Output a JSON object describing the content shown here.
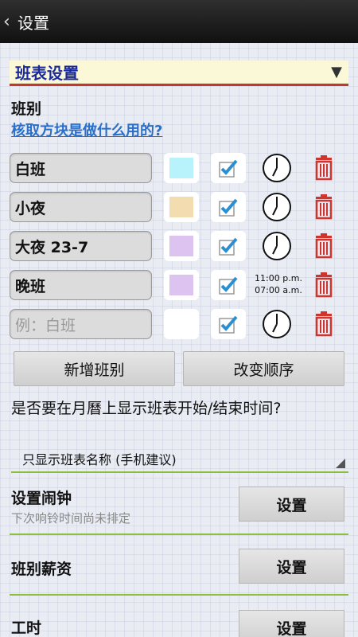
{
  "appbar": {
    "title": "设置"
  },
  "section_select": {
    "value": "班表设置"
  },
  "shifts_section": {
    "title": "班别",
    "help_link": "核取方块是做什么用的?",
    "rows": [
      {
        "name": "白班",
        "color": "#b8f2fb",
        "checked": true,
        "time": ""
      },
      {
        "name": "小夜",
        "color": "#f2dcb0",
        "checked": true,
        "time": ""
      },
      {
        "name": "大夜 23-7",
        "color": "#ddc3f0",
        "checked": true,
        "time": ""
      },
      {
        "name": "晚班",
        "color": "#ddc3f0",
        "checked": true,
        "time_start": "11:00 p.m.",
        "time_end": "07:00 a.m."
      },
      {
        "name": "",
        "placeholder": "例：白班",
        "color": "#ffffff",
        "checked": true,
        "time": ""
      }
    ],
    "add_button": "新增班别",
    "reorder_button": "改变顺序"
  },
  "calendar_display": {
    "question": "是否要在月曆上显示班表开始/结束时间?",
    "selected": "只显示班表名称 (手机建议)"
  },
  "alarm": {
    "label": "设置闹钟",
    "sub": "下次响铃时间尚未排定",
    "button": "设置"
  },
  "salary": {
    "label": "班别薪资",
    "button": "设置"
  },
  "hours": {
    "label": "工时",
    "button": "设置"
  },
  "colors": {
    "accent_red": "#c0392b",
    "divider_green": "#8bbf3c",
    "link_blue": "#2a6fc9",
    "check_blue": "#2a8fd1",
    "trash_red": "#d0342c"
  }
}
